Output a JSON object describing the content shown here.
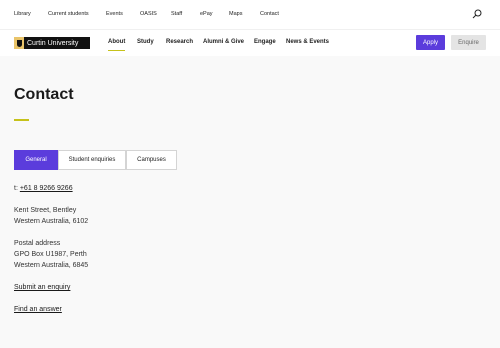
{
  "topnav": {
    "items": [
      "Library",
      "Current students",
      "Events",
      "OASIS",
      "Staff",
      "ePay",
      "Maps",
      "Contact"
    ]
  },
  "logo": {
    "text": "Curtin University"
  },
  "mainnav": {
    "items": [
      "About",
      "Study",
      "Research",
      "Alumni & Give",
      "Engage",
      "News & Events"
    ],
    "active": "About"
  },
  "actions": {
    "apply": "Apply",
    "enquire": "Enquire"
  },
  "page": {
    "title": "Contact"
  },
  "tabs": {
    "items": [
      "General",
      "Student enquiries",
      "Campuses"
    ],
    "active": "General"
  },
  "contact": {
    "phone_prefix": "t:",
    "phone": "+61 8 9266 9266",
    "street_line1": "Kent Street, Bentley",
    "street_line2": "Western Australia, 6102",
    "postal_label": "Postal address",
    "postal_line1": "GPO Box U1987, Perth",
    "postal_line2": "Western Australia, 6845",
    "submit_enquiry": "Submit an enquiry",
    "find_answer": "Find an answer"
  },
  "colors": {
    "accent": "#5b3cdc",
    "highlight": "#c6c21b"
  }
}
